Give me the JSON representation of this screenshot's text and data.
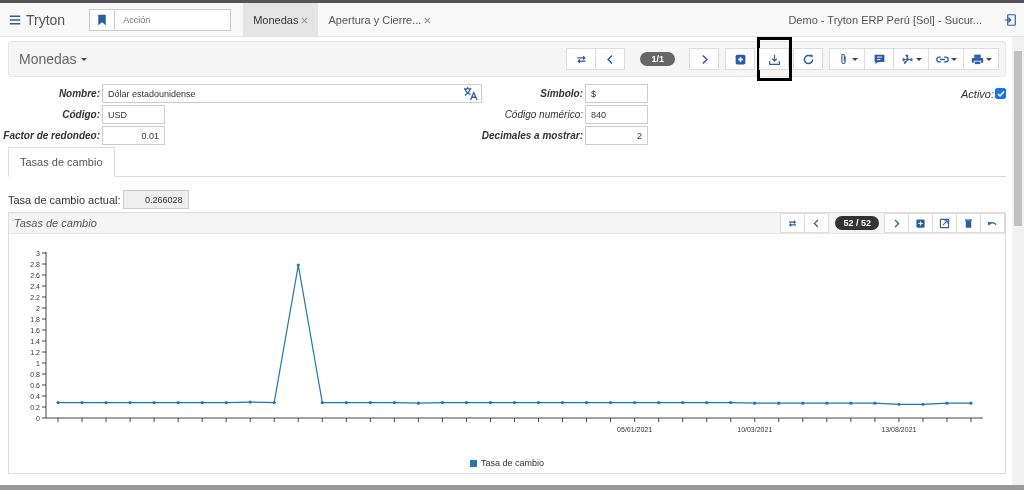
{
  "top_bar": {
    "app_title": "Tryton",
    "action_placeholder": "Acción",
    "company": "Demo - Tryton ERP Perú [Sol] - Sucur...",
    "tabs": [
      {
        "label": "Monedas",
        "selected": true
      },
      {
        "label": "Apertura y Cierre...",
        "selected": false
      }
    ]
  },
  "form": {
    "title": "Monedas",
    "record_counter": "1/1",
    "tools": [
      {
        "kind": "add",
        "highlighted": false
      },
      {
        "kind": "download",
        "highlighted": true
      },
      {
        "kind": "reload",
        "highlighted": false
      }
    ],
    "fields": [
      {
        "label": "Nombre:",
        "value": "Dólar estadounidense",
        "required": true,
        "kind": "translatable"
      },
      {
        "label": "Símbolo:",
        "value": "$",
        "required": true,
        "kind": "text"
      },
      {
        "label": "Código:",
        "value": "USD",
        "required": true,
        "kind": "text"
      },
      {
        "label": "Código numérico:",
        "value": "840",
        "required": false,
        "kind": "text"
      },
      {
        "label": "Factor de redondeo:",
        "value": "0.01",
        "required": true,
        "kind": "number"
      },
      {
        "label": "Decimales a mostrar:",
        "value": "2",
        "required": true,
        "kind": "number"
      }
    ],
    "active": {
      "label": "Activo:",
      "checked": true
    },
    "tabs": [
      {
        "label": "Tasas de cambio",
        "selected": true
      }
    ],
    "current_rate": {
      "label": "Tasa de cambio actual:",
      "value": "0.266028"
    },
    "rates_panel": {
      "title": "Tasas de cambio",
      "counter": "52 / 52",
      "chart_data": {
        "type": "line",
        "ylim": [
          0,
          3
        ],
        "categories": [
          null,
          null,
          null,
          null,
          null,
          null,
          null,
          null,
          null,
          null,
          null,
          null,
          null,
          null,
          null,
          null,
          null,
          null,
          null,
          null,
          null,
          null,
          null,
          null,
          "05/01/2021",
          null,
          null,
          null,
          null,
          "10/03/2021",
          null,
          null,
          null,
          null,
          null,
          "13/08/2021",
          null,
          null,
          null
        ],
        "yticks": [
          0,
          0.2,
          0.4,
          0.6,
          0.8,
          1,
          1.2,
          1.4,
          1.6,
          1.8,
          2,
          2.2,
          2.4,
          2.6,
          2.8,
          3
        ],
        "series": [
          {
            "name": "Tasa de cambio",
            "color": "#1f77b4",
            "values": [
              0.28,
              0.28,
              0.28,
              0.28,
              0.28,
              0.28,
              0.28,
              0.28,
              0.29,
              0.28,
              2.78,
              0.28,
              0.28,
              0.28,
              0.28,
              0.27,
              0.28,
              0.28,
              0.28,
              0.28,
              0.28,
              0.28,
              0.28,
              0.28,
              0.28,
              0.28,
              0.28,
              0.28,
              0.28,
              0.27,
              0.27,
              0.27,
              0.27,
              0.27,
              0.27,
              0.25,
              0.25,
              0.27,
              0.27
            ]
          }
        ]
      }
    }
  }
}
